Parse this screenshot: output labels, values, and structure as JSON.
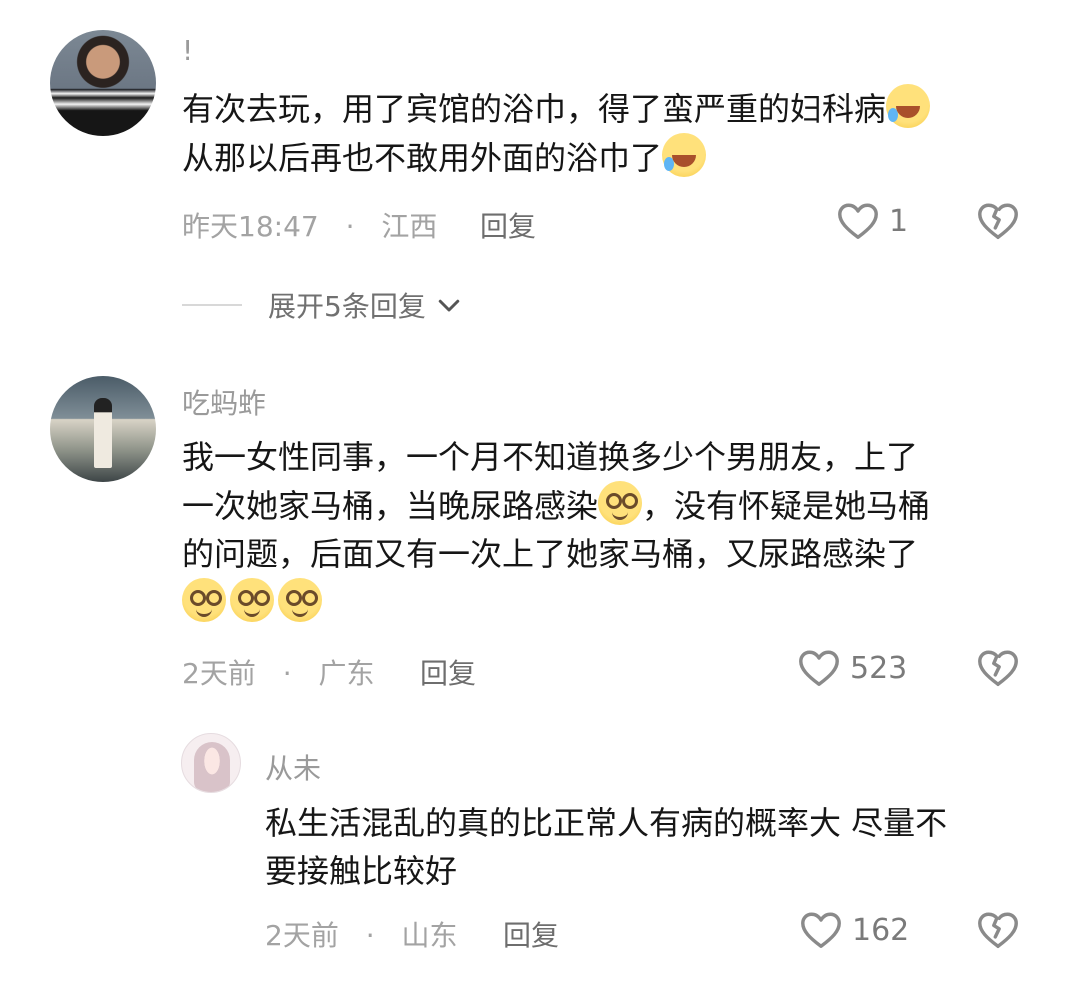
{
  "comments": [
    {
      "username": "!",
      "line1": "有次去玩，用了宾馆的浴巾，得了蛮严重的妇科病",
      "line2": "从那以后再也不敢用外面的浴巾了",
      "emoji": "laugh-cry-emoji",
      "time": "昨天18:47",
      "separator": "·",
      "location": "江西",
      "reply_label": "回复",
      "likes": "1"
    },
    {
      "username": "吃蚂蚱",
      "line1": "我一女性同事，一个月不知道换多少个男朋友，上了",
      "line2a": "一次她家马桶，当晚尿路感染",
      "line2b": "，没有怀疑是她马桶",
      "line3": "的问题，后面又有一次上了她家马桶，又尿路感染了",
      "emoji": "dizzy-emoji",
      "time": "2天前",
      "separator": "·",
      "location": "广东",
      "reply_label": "回复",
      "likes": "523"
    },
    {
      "username": "从未",
      "line1": "私生活混乱的真的比正常人有病的概率大 尽量不",
      "line2": "要接触比较好",
      "time": "2天前",
      "separator": "·",
      "location": "山东",
      "reply_label": "回复",
      "likes": "162"
    }
  ],
  "expand_replies": "展开5条回复",
  "icons": {
    "like": "heart-outline-icon",
    "dislike": "broken-heart-icon",
    "expand": "chevron-down-icon"
  },
  "colors": {
    "text": "#161616",
    "muted": "#a3a3a3",
    "reply": "#6e6e6e",
    "icon": "#8a8a8a"
  }
}
